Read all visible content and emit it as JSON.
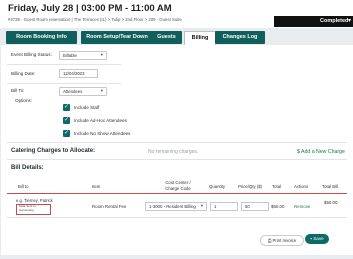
{
  "header": {
    "title": "Friday, July 28 | 03:00 PM - 11:00 AM",
    "subtitle": "#4739 - Guest Room reservation | The Terraces (IL) > Tulip > 2nd Floor > 209 - Guest Suite",
    "status": "Completed",
    "status_caret": "▾"
  },
  "tabs": [
    {
      "label": "Room Booking Info",
      "active": false
    },
    {
      "label": "Room Setup/Tear Down",
      "active": false
    },
    {
      "label": "Guests",
      "active": false
    },
    {
      "label": "Billing",
      "active": true
    },
    {
      "label": "Changes Log",
      "active": false
    }
  ],
  "billing": {
    "event_status_label": "Event Billing Status:",
    "event_status_value": "Billable",
    "date_label": "Billing Date:",
    "date_value": "12/04/2023",
    "bill_to_label": "Bill To:",
    "bill_to_value": "Attendees",
    "options_label": "Options:",
    "options": [
      {
        "label": "Include Staff",
        "checked": true
      },
      {
        "label": "Include Ad-Hoc Attendees",
        "checked": true
      },
      {
        "label": "Include No Show Attendees",
        "checked": true
      }
    ]
  },
  "catering": {
    "title": "Catering Charges to Allocate:",
    "empty_text": "No remaining charges.",
    "add_link": "$ Add a New Charge"
  },
  "bill_details": {
    "title": "Bill Details:",
    "columns": [
      "Bill to",
      "Item",
      "Cost Center / Charge Code",
      "Quantity",
      "Price/Qty ($)",
      "Total",
      "Actions",
      "Total Bill"
    ],
    "rows": [
      {
        "bill_to": "e.g. Tierney, Patrick",
        "bill_to_sub": "Data Sent to Accounting",
        "item": "Room Rental Fee",
        "cost_center": "1-3000 - Resident Billing",
        "quantity": "1",
        "price": "50",
        "total": "$50.00",
        "action": "Remove",
        "total_bill": "$50.00"
      }
    ]
  },
  "footer": {
    "print_label": "Print Invoice",
    "save_label": "Save"
  },
  "colors": {
    "tab_bg": "#105f5c",
    "accent_green": "#1a7a4c",
    "checkbox": "#0d6b67",
    "table_rule": "#c94a4a"
  }
}
